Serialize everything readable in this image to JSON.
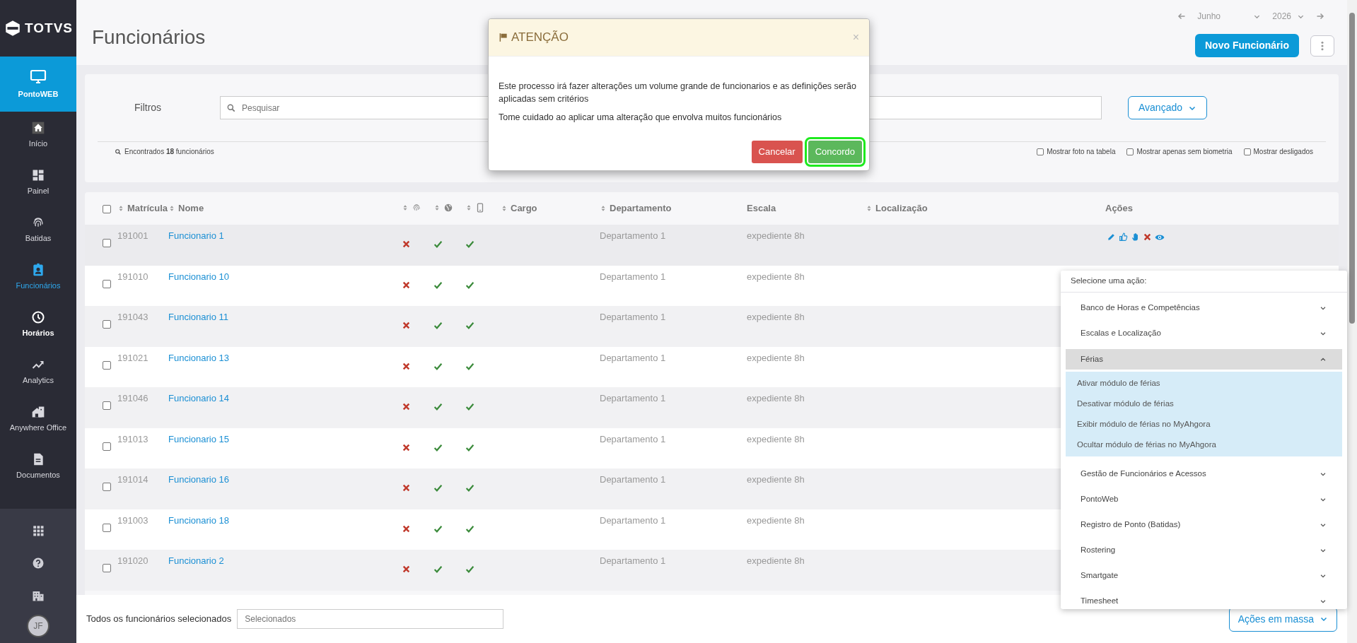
{
  "sidebar": {
    "logo": "TOTVS",
    "product": "PontoWEB",
    "items": [
      {
        "label": "Início",
        "selected": false,
        "hovered": false
      },
      {
        "label": "Painel",
        "selected": false,
        "hovered": false
      },
      {
        "label": "Batidas",
        "selected": false,
        "hovered": false
      },
      {
        "label": "Funcionários",
        "selected": true,
        "hovered": false
      },
      {
        "label": "Horários",
        "selected": false,
        "hovered": true
      },
      {
        "label": "Analytics",
        "selected": false,
        "hovered": false
      },
      {
        "label": "Anywhere Office",
        "selected": false,
        "hovered": false
      },
      {
        "label": "Documentos",
        "selected": false,
        "hovered": false
      }
    ],
    "avatar": "JF"
  },
  "header": {
    "title": "Funcionários",
    "month": "Junho",
    "year": "2026",
    "new_button": "Novo Funcionário"
  },
  "filters": {
    "label": "Filtros",
    "search_placeholder": "Pesquisar",
    "advanced_button": "Avançado",
    "found": "Encontrados **18** funcionários",
    "options": [
      {
        "label": "Mostrar foto na tabela",
        "checked": false
      },
      {
        "label": "Mostrar apenas sem biometria",
        "checked": false
      },
      {
        "label": "Mostrar desligados",
        "checked": false
      }
    ]
  },
  "table": {
    "select_all_checked": false,
    "columns": [
      {
        "label": "Matrícula",
        "sortable": true
      },
      {
        "label": "Nome",
        "sortable": true
      },
      {
        "kind": "icon",
        "sortable": true
      },
      {
        "kind": "icon",
        "sortable": true
      },
      {
        "kind": "icon",
        "sortable": true
      },
      {
        "label": "Cargo",
        "sortable": true
      },
      {
        "label": "Departamento",
        "sortable": true
      },
      {
        "label": "Escala",
        "sortable": false
      },
      {
        "label": "Localização",
        "sortable": true
      },
      {
        "label": "Ações",
        "sortable": false
      }
    ],
    "rows": [
      {
        "id": "191001",
        "name": "Funcionario 1",
        "biometry": false,
        "web": true,
        "mobile": true,
        "department": "Departamento 1",
        "schedule": "expediente 8h",
        "checked": false,
        "hovered": true
      },
      {
        "id": "191010",
        "name": "Funcionario 10",
        "biometry": false,
        "web": true,
        "mobile": true,
        "department": "Departamento 1",
        "schedule": "expediente 8h",
        "checked": false,
        "hovered": false
      },
      {
        "id": "191043",
        "name": "Funcionario 11",
        "biometry": false,
        "web": true,
        "mobile": true,
        "department": "Departamento 1",
        "schedule": "expediente 8h",
        "checked": false,
        "hovered": false
      },
      {
        "id": "191021",
        "name": "Funcionario 13",
        "biometry": false,
        "web": true,
        "mobile": true,
        "department": "Departamento 1",
        "schedule": "expediente 8h",
        "checked": false,
        "hovered": false
      },
      {
        "id": "191046",
        "name": "Funcionario 14",
        "biometry": false,
        "web": true,
        "mobile": true,
        "department": "Departamento 1",
        "schedule": "expediente 8h",
        "checked": false,
        "hovered": false
      },
      {
        "id": "191013",
        "name": "Funcionario 15",
        "biometry": false,
        "web": true,
        "mobile": true,
        "department": "Departamento 1",
        "schedule": "expediente 8h",
        "checked": false,
        "hovered": false
      },
      {
        "id": "191014",
        "name": "Funcionario 16",
        "biometry": false,
        "web": true,
        "mobile": true,
        "department": "Departamento 1",
        "schedule": "expediente 8h",
        "checked": false,
        "hovered": false
      },
      {
        "id": "191003",
        "name": "Funcionario 18",
        "biometry": false,
        "web": true,
        "mobile": true,
        "department": "Departamento 1",
        "schedule": "expediente 8h",
        "checked": false,
        "hovered": false
      },
      {
        "id": "191020",
        "name": "Funcionario 2",
        "biometry": false,
        "web": true,
        "mobile": true,
        "department": "Departamento 1",
        "schedule": "expediente 8h",
        "checked": false,
        "hovered": false
      }
    ]
  },
  "bottom_bar": {
    "label": "Todos os funcionários selecionados",
    "placeholder": "Selecionados",
    "mass_button": "Ações em massa"
  },
  "action_menu": {
    "title": "Selecione uma ação:",
    "groups": [
      {
        "label": "Banco de Horas e Competências",
        "expanded": false
      },
      {
        "label": "Escalas e Localização",
        "expanded": false
      },
      {
        "label": "Férias",
        "expanded": true,
        "children": [
          "Ativar módulo de férias",
          "Desativar módulo de férias",
          "Exibir módulo de férias no MyAhgora",
          "Ocultar módulo de férias no MyAhgora"
        ]
      },
      {
        "label": "Gestão de Funcionários e Acessos",
        "expanded": false
      },
      {
        "label": "PontoWeb",
        "expanded": false
      },
      {
        "label": "Registro de Ponto (Batidas)",
        "expanded": false
      },
      {
        "label": "Rostering",
        "expanded": false
      },
      {
        "label": "Smartgate",
        "expanded": false
      },
      {
        "label": "Timesheet",
        "expanded": false
      }
    ]
  },
  "modal": {
    "title": "ATENÇÃO",
    "close": "×",
    "paragraphs": [
      "Este processo irá fazer alterações um volume grande de funcionarios e as definições serão aplicadas sem critérios",
      "Tome cuidado ao aplicar uma alteração que envolva muitos funcionários"
    ],
    "buttons": [
      {
        "label": "Cancelar",
        "kind": "danger",
        "highlighted": false
      },
      {
        "label": "Concordo",
        "kind": "success",
        "highlighted": true
      }
    ]
  }
}
